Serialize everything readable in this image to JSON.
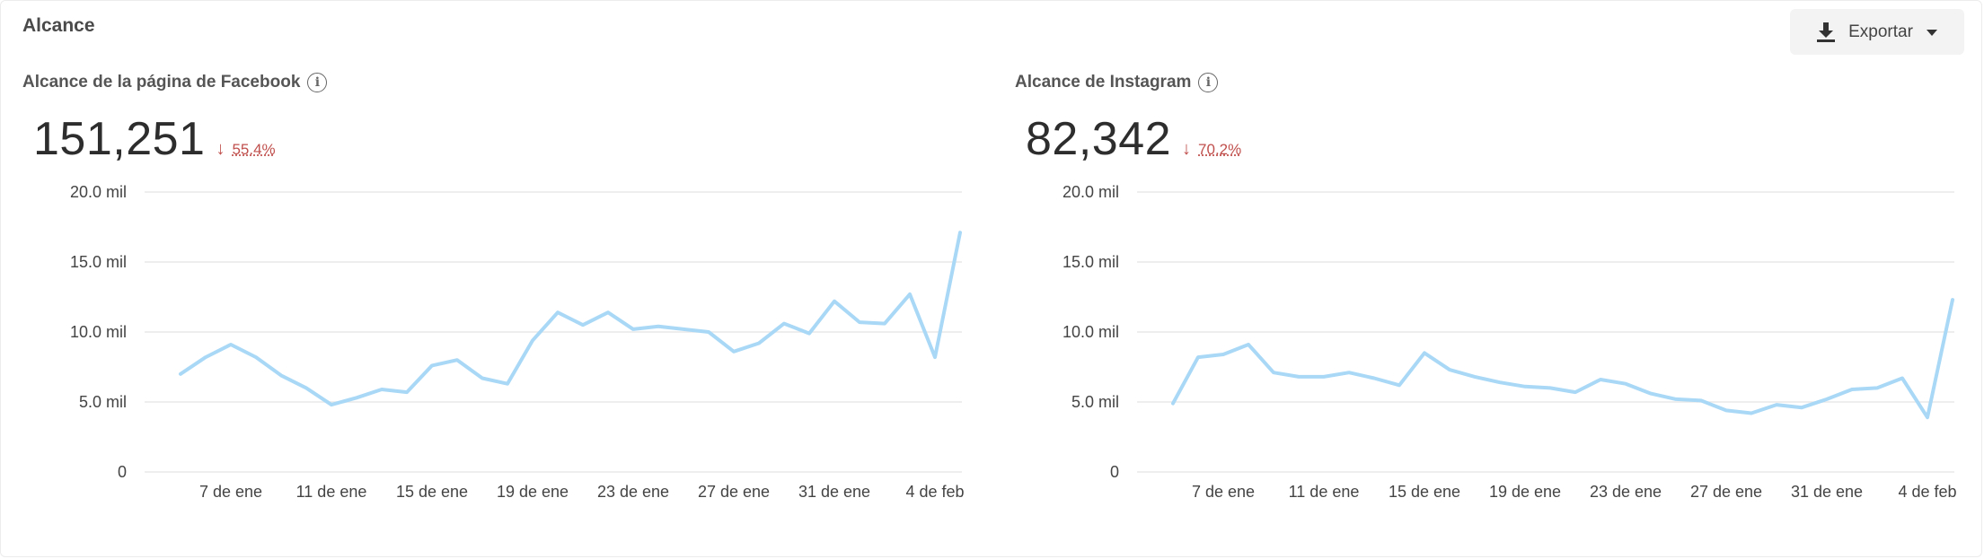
{
  "section": {
    "title": "Alcance"
  },
  "export": {
    "label": "Exportar",
    "icon": "download-icon",
    "caret": "caret-down-icon"
  },
  "colors": {
    "line": "#a8d8f6",
    "grid": "#e8e8e8",
    "negative": "#c0504d"
  },
  "panels": [
    {
      "title": "Alcance de la página de Facebook",
      "value": "151,251",
      "change": "55.4%",
      "change_direction": "down"
    },
    {
      "title": "Alcance de Instagram",
      "value": "82,342",
      "change": "70.2%",
      "change_direction": "down"
    }
  ],
  "chart_data": [
    {
      "type": "line",
      "title": "Alcance de la página de Facebook",
      "y_ticks": [
        "0",
        "5.0 mil",
        "10.0 mil",
        "15.0 mil",
        "20.0 mil"
      ],
      "ylim": [
        0,
        20000
      ],
      "x_ticks": [
        "7 de ene",
        "11 de ene",
        "15 de ene",
        "19 de ene",
        "23 de ene",
        "27 de ene",
        "31 de ene",
        "4 de feb"
      ],
      "x": [
        "5 de ene",
        "6 de ene",
        "7 de ene",
        "8 de ene",
        "9 de ene",
        "10 de ene",
        "11 de ene",
        "12 de ene",
        "13 de ene",
        "14 de ene",
        "15 de ene",
        "16 de ene",
        "17 de ene",
        "18 de ene",
        "19 de ene",
        "20 de ene",
        "21 de ene",
        "22 de ene",
        "23 de ene",
        "24 de ene",
        "25 de ene",
        "26 de ene",
        "27 de ene",
        "28 de ene",
        "29 de ene",
        "30 de ene",
        "31 de ene",
        "1 de feb",
        "2 de feb",
        "3 de feb",
        "4 de feb",
        "5 de feb"
      ],
      "values": [
        7000,
        8200,
        9100,
        8200,
        6900,
        6000,
        4800,
        5300,
        5900,
        5700,
        7600,
        8000,
        6700,
        6300,
        9400,
        11400,
        10500,
        11400,
        10200,
        10400,
        10200,
        10000,
        8600,
        9200,
        10600,
        9900,
        12200,
        10700,
        10600,
        12700,
        8200,
        17100
      ],
      "grid": true
    },
    {
      "type": "line",
      "title": "Alcance de Instagram",
      "y_ticks": [
        "0",
        "5.0 mil",
        "10.0 mil",
        "15.0 mil",
        "20.0 mil"
      ],
      "ylim": [
        0,
        20000
      ],
      "x_ticks": [
        "7 de ene",
        "11 de ene",
        "15 de ene",
        "19 de ene",
        "23 de ene",
        "27 de ene",
        "31 de ene",
        "4 de feb"
      ],
      "x": [
        "5 de ene",
        "6 de ene",
        "7 de ene",
        "8 de ene",
        "9 de ene",
        "10 de ene",
        "11 de ene",
        "12 de ene",
        "13 de ene",
        "14 de ene",
        "15 de ene",
        "16 de ene",
        "17 de ene",
        "18 de ene",
        "19 de ene",
        "20 de ene",
        "21 de ene",
        "22 de ene",
        "23 de ene",
        "24 de ene",
        "25 de ene",
        "26 de ene",
        "27 de ene",
        "28 de ene",
        "29 de ene",
        "30 de ene",
        "31 de ene",
        "1 de feb",
        "2 de feb",
        "3 de feb",
        "4 de feb",
        "5 de feb"
      ],
      "values": [
        4900,
        8200,
        8400,
        9100,
        7100,
        6800,
        6800,
        7100,
        6700,
        6200,
        8500,
        7300,
        6800,
        6400,
        6100,
        6000,
        5700,
        6600,
        6300,
        5600,
        5200,
        5100,
        4400,
        4200,
        4800,
        4600,
        5200,
        5900,
        6000,
        6700,
        3900,
        12300
      ],
      "grid": true
    }
  ]
}
